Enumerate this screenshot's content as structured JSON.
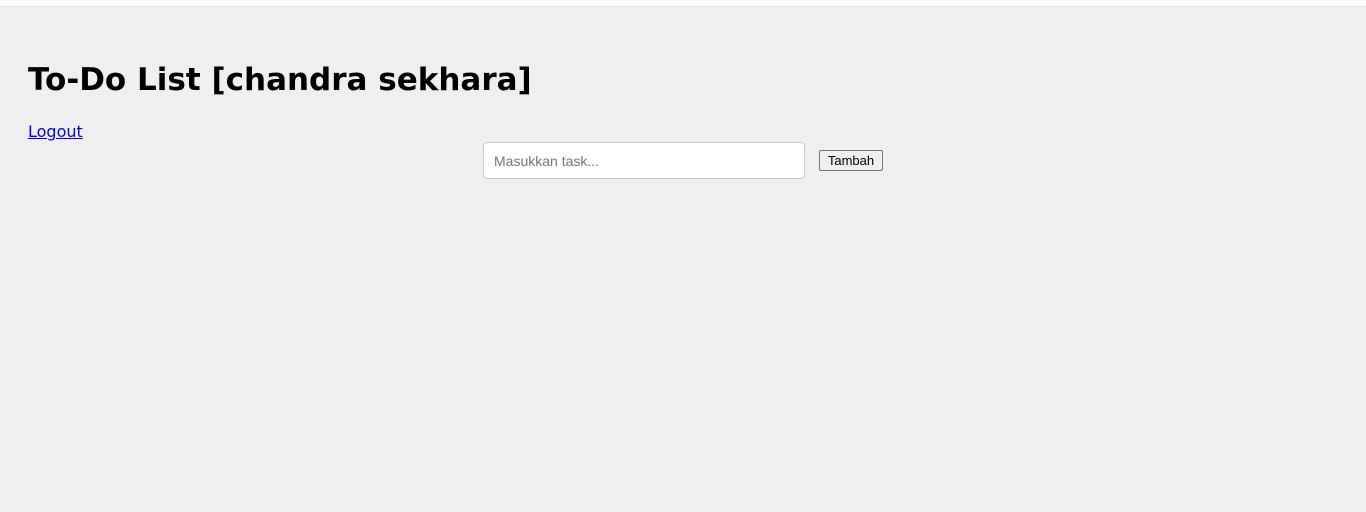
{
  "header": {
    "title": "To-Do List [chandra sekhara]"
  },
  "nav": {
    "logout_label": "Logout"
  },
  "task_form": {
    "input_value": "",
    "input_placeholder": "Masukkan task...",
    "add_button_label": "Tambah"
  },
  "colors": {
    "background": "#efefef",
    "link": "#0000ee"
  }
}
